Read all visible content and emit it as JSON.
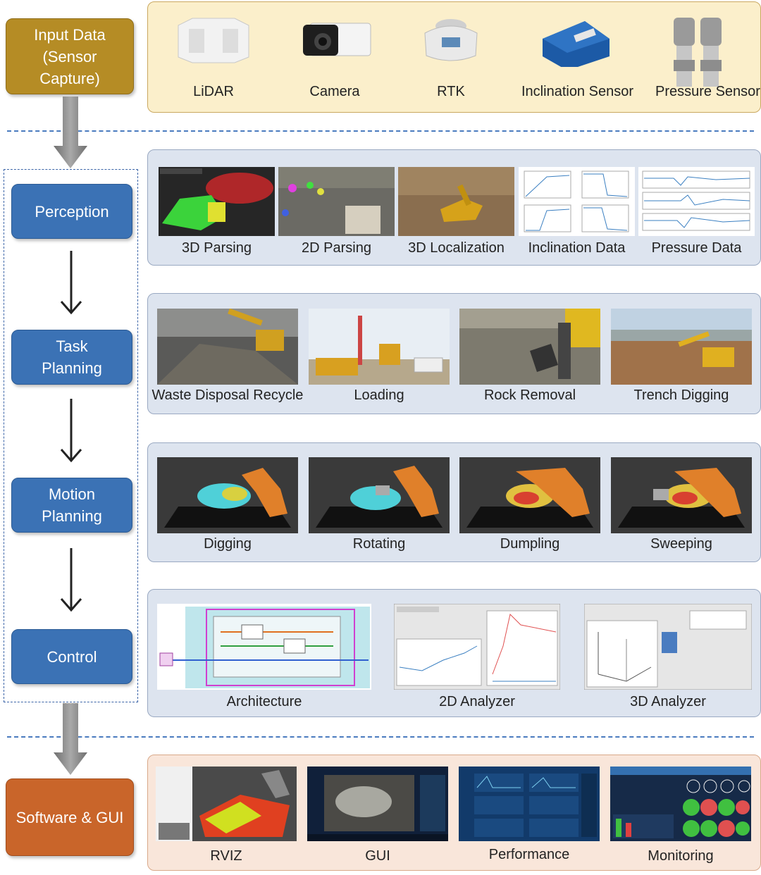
{
  "stages": {
    "input": "Input Data\n(Sensor\nCapture)",
    "perception": "Perception",
    "task": "Task\nPlanning",
    "motion": "Motion\nPlanning",
    "control": "Control",
    "software": "Software & GUI"
  },
  "sensors": [
    "LiDAR",
    "Camera",
    "RTK",
    "Inclination Sensor",
    "Pressure Sensor"
  ],
  "perception": [
    "3D Parsing",
    "2D Parsing",
    "3D Localization",
    "Inclination Data",
    "Pressure Data"
  ],
  "task_planning": [
    "Waste Disposal Recycle",
    "Loading",
    "Rock Removal",
    "Trench Digging"
  ],
  "motion_planning": [
    "Digging",
    "Rotating",
    "Dumpling",
    "Sweeping"
  ],
  "control": [
    "Architecture",
    "2D Analyzer",
    "3D Analyzer"
  ],
  "software": [
    "RVIZ",
    "GUI",
    "Performance",
    "Monitoring"
  ],
  "colors": {
    "stage_blue": "#3b72b5",
    "stage_gold": "#b58c25",
    "stage_orange": "#c9652a",
    "panel_blue": "#dde4ef",
    "panel_cream": "#fbefcb",
    "panel_peach": "#f9e6da"
  }
}
